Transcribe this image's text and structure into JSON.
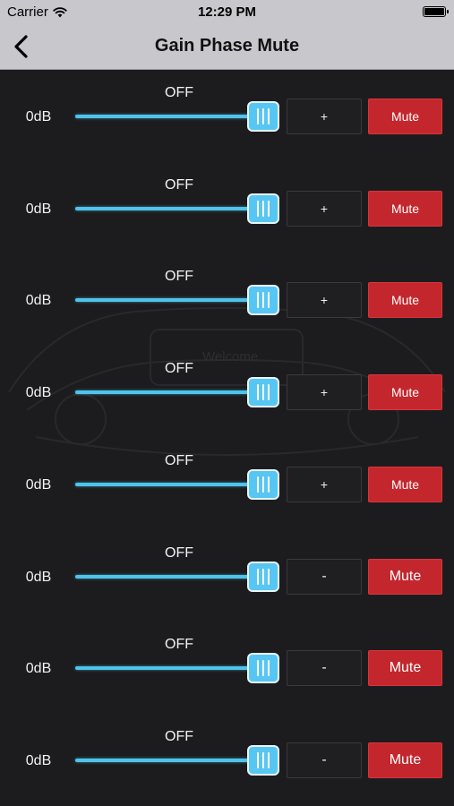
{
  "status_bar": {
    "carrier": "Carrier",
    "time": "12:29 PM",
    "wifi_icon": "wifi-icon",
    "battery_icon": "battery-icon"
  },
  "nav": {
    "title": "Gain Phase Mute",
    "back_icon": "chevron-left-icon"
  },
  "watermark": {
    "text": "Welcome"
  },
  "colors": {
    "accent": "#58c6f2",
    "mute": "#c3272d",
    "background": "#1c1c1e",
    "nav_background": "#c8c8cc"
  },
  "channels": [
    {
      "gain": "0dB",
      "phase_label": "OFF",
      "phase_button": "+",
      "mute_label": "Mute",
      "slider_level": 1.0
    },
    {
      "gain": "0dB",
      "phase_label": "OFF",
      "phase_button": "+",
      "mute_label": "Mute",
      "slider_level": 1.0
    },
    {
      "gain": "0dB",
      "phase_label": "OFF",
      "phase_button": "+",
      "mute_label": "Mute",
      "slider_level": 1.0
    },
    {
      "gain": "0dB",
      "phase_label": "OFF",
      "phase_button": "+",
      "mute_label": "Mute",
      "slider_level": 1.0
    },
    {
      "gain": "0dB",
      "phase_label": "OFF",
      "phase_button": "+",
      "mute_label": "Mute",
      "slider_level": 1.0
    },
    {
      "gain": "0dB",
      "phase_label": "OFF",
      "phase_button": "-",
      "mute_label": "Mute",
      "slider_level": 1.0
    },
    {
      "gain": "0dB",
      "phase_label": "OFF",
      "phase_button": "-",
      "mute_label": "Mute",
      "slider_level": 1.0
    },
    {
      "gain": "0dB",
      "phase_label": "OFF",
      "phase_button": "-",
      "mute_label": "Mute",
      "slider_level": 1.0
    }
  ]
}
